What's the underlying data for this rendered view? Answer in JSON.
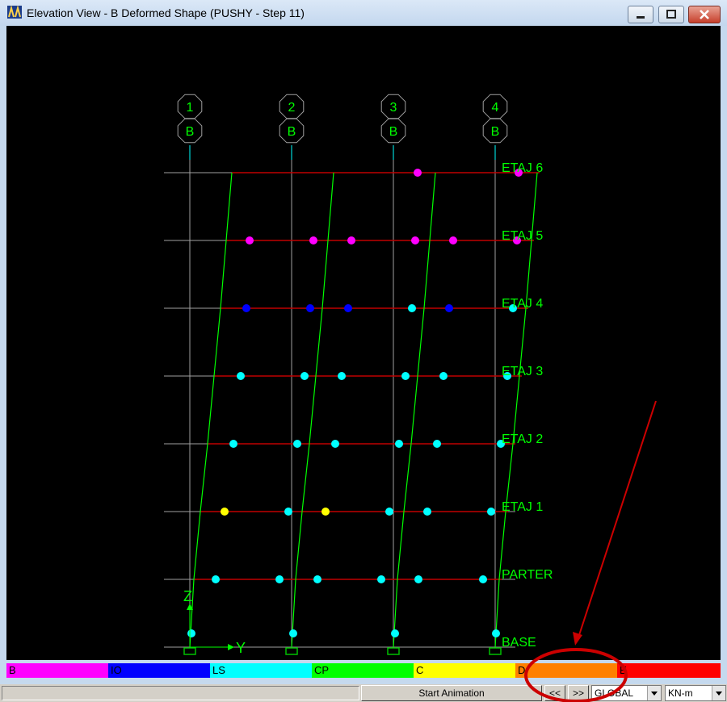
{
  "window": {
    "title": "Elevation View - B  Deformed Shape (PUSHY - Step 11)",
    "buttons": [
      "minimize",
      "maximize",
      "close"
    ]
  },
  "view": {
    "grid_lines": [
      {
        "number": "1",
        "letter": "B"
      },
      {
        "number": "2",
        "letter": "B"
      },
      {
        "number": "3",
        "letter": "B"
      },
      {
        "number": "4",
        "letter": "B"
      }
    ],
    "story_labels": [
      "ETAJ 6",
      "ETAJ 5",
      "ETAJ 4",
      "ETAJ 3",
      "ETAJ 2",
      "ETAJ 1",
      "PARTER",
      "BASE"
    ],
    "axis_labels": {
      "z": "Z",
      "y": "Y"
    },
    "colors": {
      "background": "#000000",
      "grid": "#a0a0a0",
      "deformed": "#00ff00",
      "beam": "#c00000",
      "label": "#00ff00",
      "support": "#00c000",
      "annotation": "#cc0000"
    }
  },
  "legend": [
    {
      "label": "B",
      "color": "#ff00ff"
    },
    {
      "label": "IO",
      "color": "#0000ff"
    },
    {
      "label": "LS",
      "color": "#00ffff"
    },
    {
      "label": "CP",
      "color": "#00ff00"
    },
    {
      "label": "C",
      "color": "#ffff00"
    },
    {
      "label": "D",
      "color": "#ff8000"
    },
    {
      "label": "E",
      "color": "#ff0000"
    }
  ],
  "status": {
    "start_animation": "Start Animation",
    "prev": "<<",
    "next": ">>",
    "coord_system": "GLOBAL",
    "units": "KN-m"
  }
}
